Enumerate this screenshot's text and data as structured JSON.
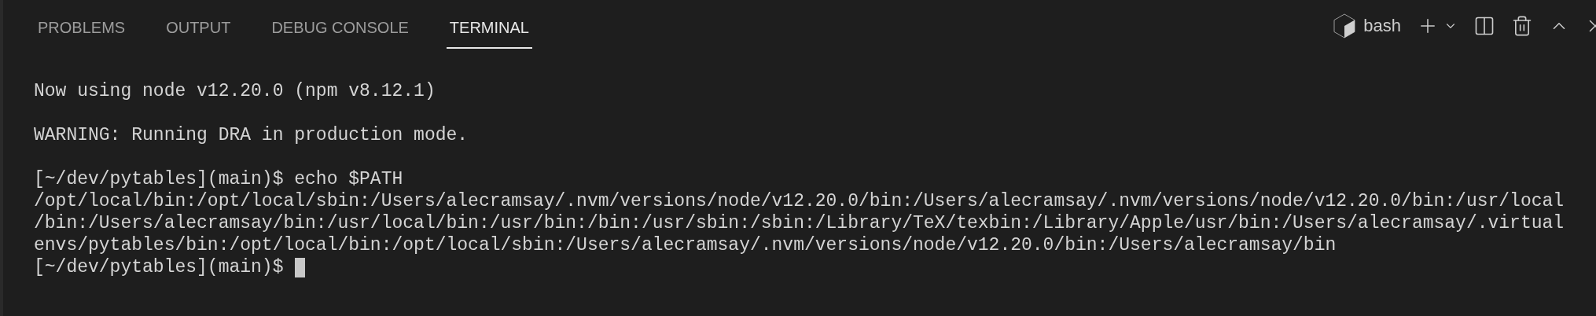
{
  "tabs": [
    {
      "label": "PROBLEMS",
      "selected": false
    },
    {
      "label": "OUTPUT",
      "selected": false
    },
    {
      "label": "DEBUG CONSOLE",
      "selected": false
    },
    {
      "label": "TERMINAL",
      "selected": true
    }
  ],
  "toolbar": {
    "shell": "bash"
  },
  "terminal": {
    "lines": [
      {
        "kind": "output",
        "text": "Now using node v12.20.0 (npm v8.12.1)"
      },
      {
        "kind": "blank"
      },
      {
        "kind": "output",
        "text": "WARNING: Running DRA in production mode."
      },
      {
        "kind": "blank"
      },
      {
        "kind": "output",
        "text": "[~/dev/pytables](main)$ echo $PATH"
      },
      {
        "kind": "output",
        "text": "/opt/local/bin:/opt/local/sbin:/Users/alecramsay/.nvm/versions/node/v12.20.0/bin:/Users/alecramsay/.nvm/versions/node/v12.20.0/bin:/usr/local"
      },
      {
        "kind": "output",
        "text": "/bin:/Users/alecramsay/bin:/usr/local/bin:/usr/bin:/bin:/usr/sbin:/sbin:/Library/TeX/texbin:/Library/Apple/usr/bin:/Users/alecramsay/.virtual"
      },
      {
        "kind": "output",
        "text": "envs/pytables/bin:/opt/local/bin:/opt/local/sbin:/Users/alecramsay/.nvm/versions/node/v12.20.0/bin:/Users/alecramsay/bin"
      },
      {
        "kind": "prompt",
        "text": "[~/dev/pytables](main)$"
      }
    ]
  }
}
